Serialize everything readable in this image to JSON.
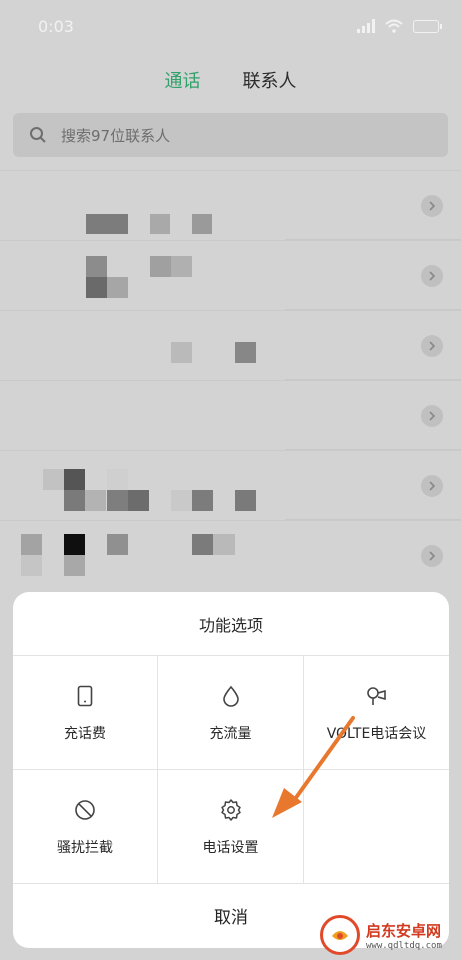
{
  "status_bar": {
    "time": "0:03"
  },
  "tabs": [
    {
      "label": "通话",
      "active": true
    },
    {
      "label": "联系人",
      "active": false
    }
  ],
  "search": {
    "placeholder": "搜索97位联系人"
  },
  "contact_rows": [
    {
      "name_redacted": true
    },
    {
      "name_redacted": true
    },
    {
      "name_redacted": true
    },
    {
      "name_redacted": true
    },
    {
      "name_redacted": true
    },
    {
      "name_redacted": true
    }
  ],
  "sheet": {
    "title": "功能选项",
    "options": [
      {
        "label": "充话费",
        "icon": "phone-device-icon"
      },
      {
        "label": "充流量",
        "icon": "water-drop-icon"
      },
      {
        "label": "VOLTE电话会议",
        "icon": "conference-icon"
      },
      {
        "label": "骚扰拦截",
        "icon": "block-icon"
      },
      {
        "label": "电话设置",
        "icon": "gear-icon"
      },
      {
        "label": "",
        "icon": ""
      }
    ],
    "cancel_label": "取消"
  },
  "annotation": {
    "arrow_color": "#e8782e"
  },
  "colors": {
    "accent": "#32a26a",
    "overlay": "#d3d3d3"
  },
  "watermark": {
    "name": "启东安卓网",
    "url": "www.qdltdq.com"
  }
}
